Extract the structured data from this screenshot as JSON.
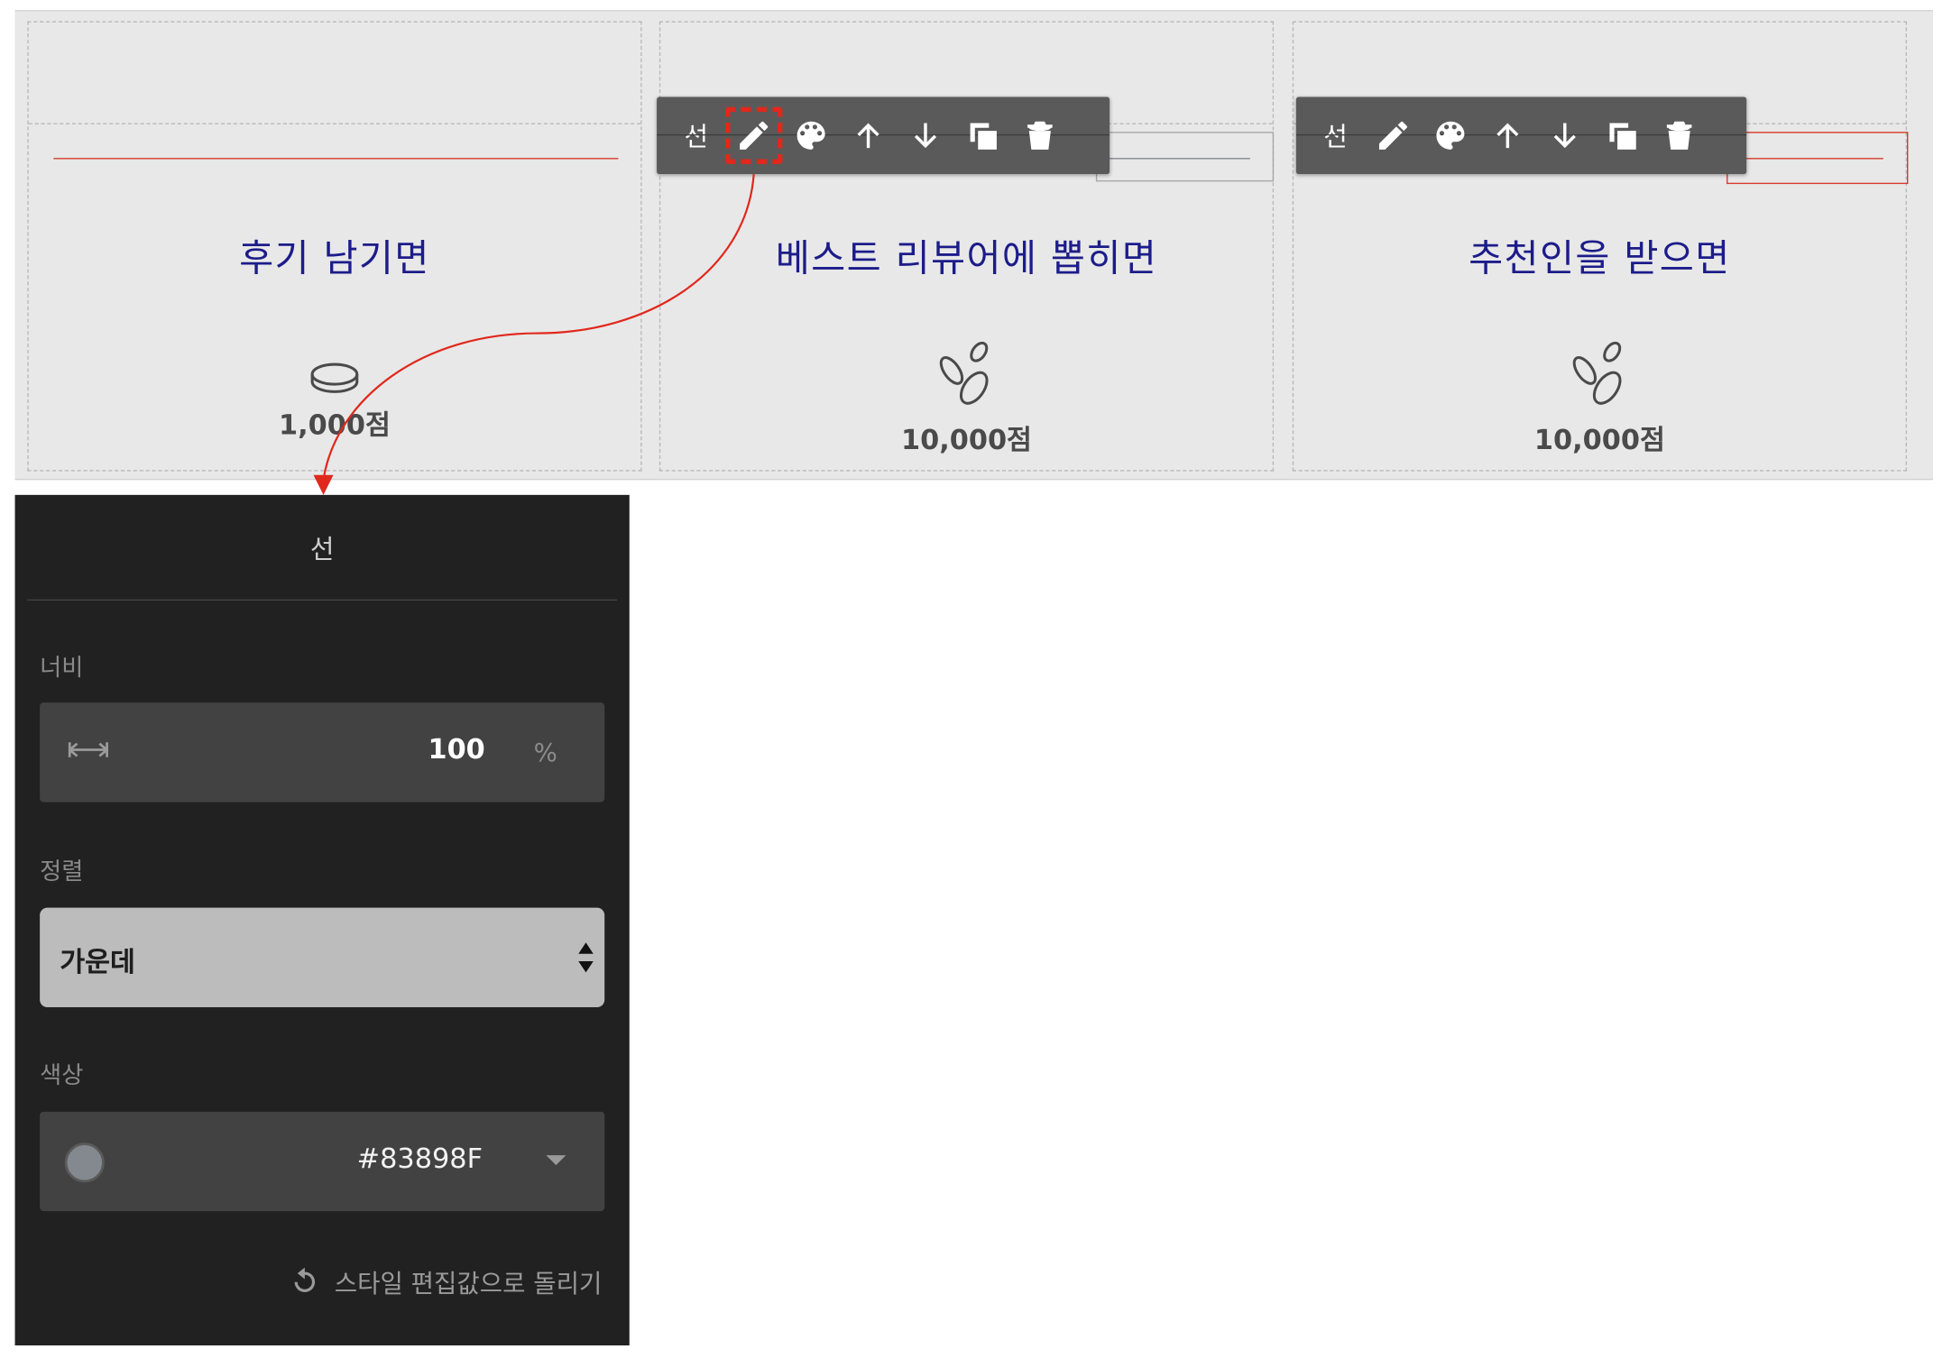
{
  "canvas": {
    "columns": [
      {
        "title": "후기 남기면",
        "points": "1,000점",
        "coin": "single-coin-icon",
        "line_color": "#d8392a"
      },
      {
        "title": "베스트 리뷰어에 뽑히면",
        "points": "10,000점",
        "coin": "coin-pile-icon",
        "line_color": "#83898F"
      },
      {
        "title": "추천인을 받으면",
        "points": "10,000점",
        "coin": "coin-pile-icon",
        "line_color": "#d8392a"
      }
    ]
  },
  "toolbar": {
    "label": "선",
    "buttons": [
      "edit-pencil-icon",
      "palette-icon",
      "arrow-up-icon",
      "arrow-down-icon",
      "duplicate-icon",
      "trash-icon"
    ],
    "selected": "edit-pencil-icon",
    "highlight_color": "#e0281c"
  },
  "panel": {
    "title": "선",
    "width": {
      "label": "너비",
      "value": "100",
      "unit": "%",
      "icon": "width-arrows-icon"
    },
    "align": {
      "label": "정렬",
      "value": "가운데",
      "icon": "sort-arrows-icon"
    },
    "color": {
      "label": "색상",
      "value": "#83898F",
      "swatch": "#83898F",
      "icon": "dropdown-caret-icon"
    },
    "reset_label": "스타일 편집값으로 돌리기",
    "reset_icon": "reset-icon"
  },
  "colors": {
    "title_text": "#1c1c8a",
    "panel_bg": "#212121",
    "toolbar_bg": "#5a5a5a"
  }
}
